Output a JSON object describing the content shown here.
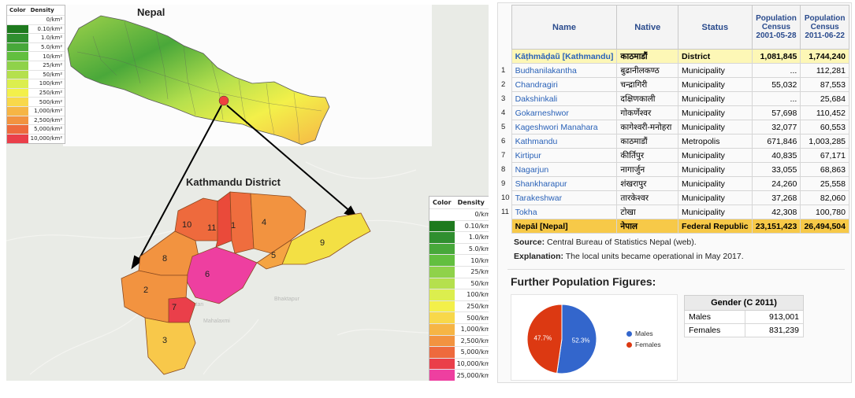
{
  "maps": {
    "nepal_title": "Nepal",
    "district_title": "Kathmandu District",
    "legend_small": {
      "header_color": "Color",
      "header_density": "Density",
      "rows": [
        {
          "color": "#ffffff",
          "label": "0/km²"
        },
        {
          "color": "#1e7a1e",
          "label": "0.10/km²"
        },
        {
          "color": "#2f8f2f",
          "label": "1.0/km²"
        },
        {
          "color": "#47a83a",
          "label": "5.0/km²"
        },
        {
          "color": "#62bf3f",
          "label": "10/km²"
        },
        {
          "color": "#8fd24a",
          "label": "25/km²"
        },
        {
          "color": "#b5e04d",
          "label": "50/km²"
        },
        {
          "color": "#dcee4e",
          "label": "100/km²"
        },
        {
          "color": "#f3f04a",
          "label": "250/km²"
        },
        {
          "color": "#f8d84a",
          "label": "500/km²"
        },
        {
          "color": "#f6b545",
          "label": "1,000/km²"
        },
        {
          "color": "#f29340",
          "label": "2,500/km²"
        },
        {
          "color": "#ee6a3d",
          "label": "5,000/km²"
        },
        {
          "color": "#ea3f4a",
          "label": "10,000/km²"
        }
      ]
    },
    "legend_large": {
      "header_color": "Color",
      "header_density": "Density",
      "rows": [
        {
          "color": "#ffffff",
          "label": "0/km²"
        },
        {
          "color": "#1e7a1e",
          "label": "0.10/km²"
        },
        {
          "color": "#2f8f2f",
          "label": "1.0/km²"
        },
        {
          "color": "#47a83a",
          "label": "5.0/km²"
        },
        {
          "color": "#62bf3f",
          "label": "10/km²"
        },
        {
          "color": "#8fd24a",
          "label": "25/km²"
        },
        {
          "color": "#b5e04d",
          "label": "50/km²"
        },
        {
          "color": "#dcee4e",
          "label": "100/km²"
        },
        {
          "color": "#f3f04a",
          "label": "250/km²"
        },
        {
          "color": "#f8d84a",
          "label": "500/km²"
        },
        {
          "color": "#f6b545",
          "label": "1,000/km²"
        },
        {
          "color": "#f29340",
          "label": "2,500/km²"
        },
        {
          "color": "#ee6a3d",
          "label": "5,000/km²"
        },
        {
          "color": "#ea3f4a",
          "label": "10,000/km²"
        },
        {
          "color": "#ee3fa0",
          "label": "25,000/km²"
        }
      ]
    },
    "district_labels": [
      "1",
      "2",
      "3",
      "4",
      "5",
      "6",
      "7",
      "8",
      "9",
      "10",
      "11"
    ],
    "place_labels": [
      "Patan",
      "Bhaktapur",
      "Mahalaxmi",
      "Tokha",
      "Banepa",
      "Dhulikhel"
    ]
  },
  "table": {
    "headers": {
      "name": "Name",
      "native": "Native",
      "status": "Status",
      "pop1": "Population",
      "pop1_sub1": "Census",
      "pop1_sub2": "2001-05-28",
      "pop2": "Population",
      "pop2_sub1": "Census",
      "pop2_sub2": "2011-06-22"
    },
    "district_row": {
      "name": "Kāṭhmāḍaũ [Kathmandu]",
      "native": "काठमाडौं",
      "status": "District",
      "pop2001": "1,081,845",
      "pop2011": "1,744,240"
    },
    "rows": [
      {
        "idx": "1",
        "name": "Budhanilakantha",
        "native": "बुढानीलकण्ठ",
        "status": "Municipality",
        "pop2001": "...",
        "pop2011": "112,281"
      },
      {
        "idx": "2",
        "name": "Chandragiri",
        "native": "चन्द्रागिरी",
        "status": "Municipality",
        "pop2001": "55,032",
        "pop2011": "87,553"
      },
      {
        "idx": "3",
        "name": "Dakshinkali",
        "native": "दक्षिणकाली",
        "status": "Municipality",
        "pop2001": "...",
        "pop2011": "25,684"
      },
      {
        "idx": "4",
        "name": "Gokarneshwor",
        "native": "गोकर्णेश्वर",
        "status": "Municipality",
        "pop2001": "57,698",
        "pop2011": "110,452"
      },
      {
        "idx": "5",
        "name": "Kageshwori Manahara",
        "native": "कागेश्वरी-मनोहरा",
        "status": "Municipality",
        "pop2001": "32,077",
        "pop2011": "60,553"
      },
      {
        "idx": "6",
        "name": "Kathmandu",
        "native": "काठमाडौं",
        "status": "Metropolis",
        "pop2001": "671,846",
        "pop2011": "1,003,285"
      },
      {
        "idx": "7",
        "name": "Kirtipur",
        "native": "कीर्तिपुर",
        "status": "Municipality",
        "pop2001": "40,835",
        "pop2011": "67,171"
      },
      {
        "idx": "8",
        "name": "Nagarjun",
        "native": "नागार्जुन",
        "status": "Municipality",
        "pop2001": "33,055",
        "pop2011": "68,863"
      },
      {
        "idx": "9",
        "name": "Shankharapur",
        "native": "शंखरापुर",
        "status": "Municipality",
        "pop2001": "24,260",
        "pop2011": "25,558"
      },
      {
        "idx": "10",
        "name": "Tarakeshwar",
        "native": "तारकेश्वर",
        "status": "Municipality",
        "pop2001": "37,268",
        "pop2011": "82,060"
      },
      {
        "idx": "11",
        "name": "Tokha",
        "native": "टोखा",
        "status": "Municipality",
        "pop2001": "42,308",
        "pop2011": "100,780"
      }
    ],
    "nepal_row": {
      "name": "Nepāl [Nepal]",
      "native": "नेपाल",
      "status": "Federal Republic",
      "pop2001": "23,151,423",
      "pop2011": "26,494,504"
    }
  },
  "notes": {
    "source_label": "Source:",
    "source_text": " Central Bureau of Statistics Nepal (web).",
    "explanation_label": "Explanation:",
    "explanation_text": " The local units became operational in May 2017."
  },
  "further": {
    "title": "Further Population Figures:",
    "gender_header": "Gender (C 2011)",
    "males_label": "Males",
    "males_value": "913,001",
    "females_label": "Females",
    "females_value": "831,239"
  },
  "chart_data": {
    "type": "pie",
    "categories": [
      "Males",
      "Females"
    ],
    "values": [
      52.3,
      47.7
    ],
    "labels": [
      "52.3%",
      "47.7%"
    ],
    "colors": [
      "#3366cc",
      "#dc3912"
    ],
    "legend_position": "right"
  }
}
